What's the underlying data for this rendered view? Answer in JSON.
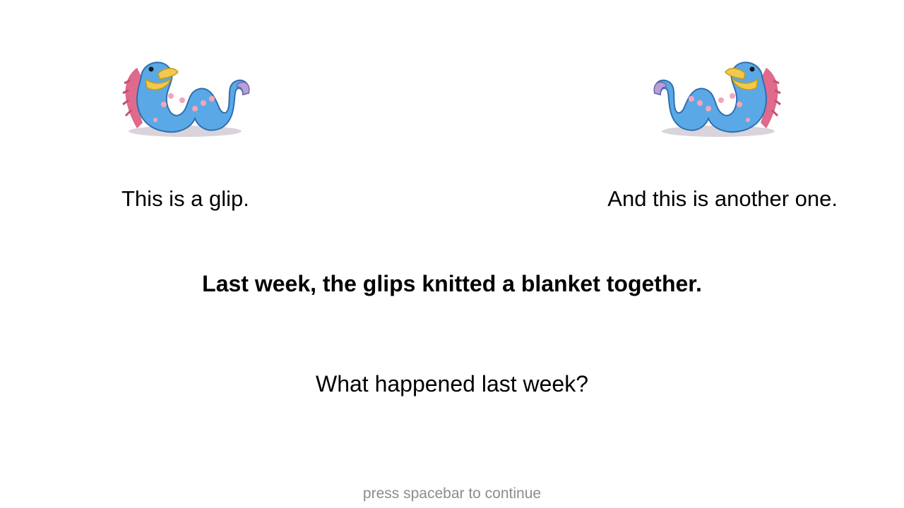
{
  "slide": {
    "creature_icon": "glip-creature-illustration",
    "caption_left": "This is a glip.",
    "caption_right": "And this is another one.",
    "story_sentence": "Last week, the glips knitted a blanket together.",
    "question": "What happened last week?",
    "continue_hint": "press spacebar to continue"
  },
  "colors": {
    "background": "#ffffff",
    "text": "#000000",
    "hint_text": "#8c8c8c",
    "creature_body": "#5aa9e6",
    "creature_beak": "#f2c94c",
    "creature_spots": "#f4a6b8"
  }
}
